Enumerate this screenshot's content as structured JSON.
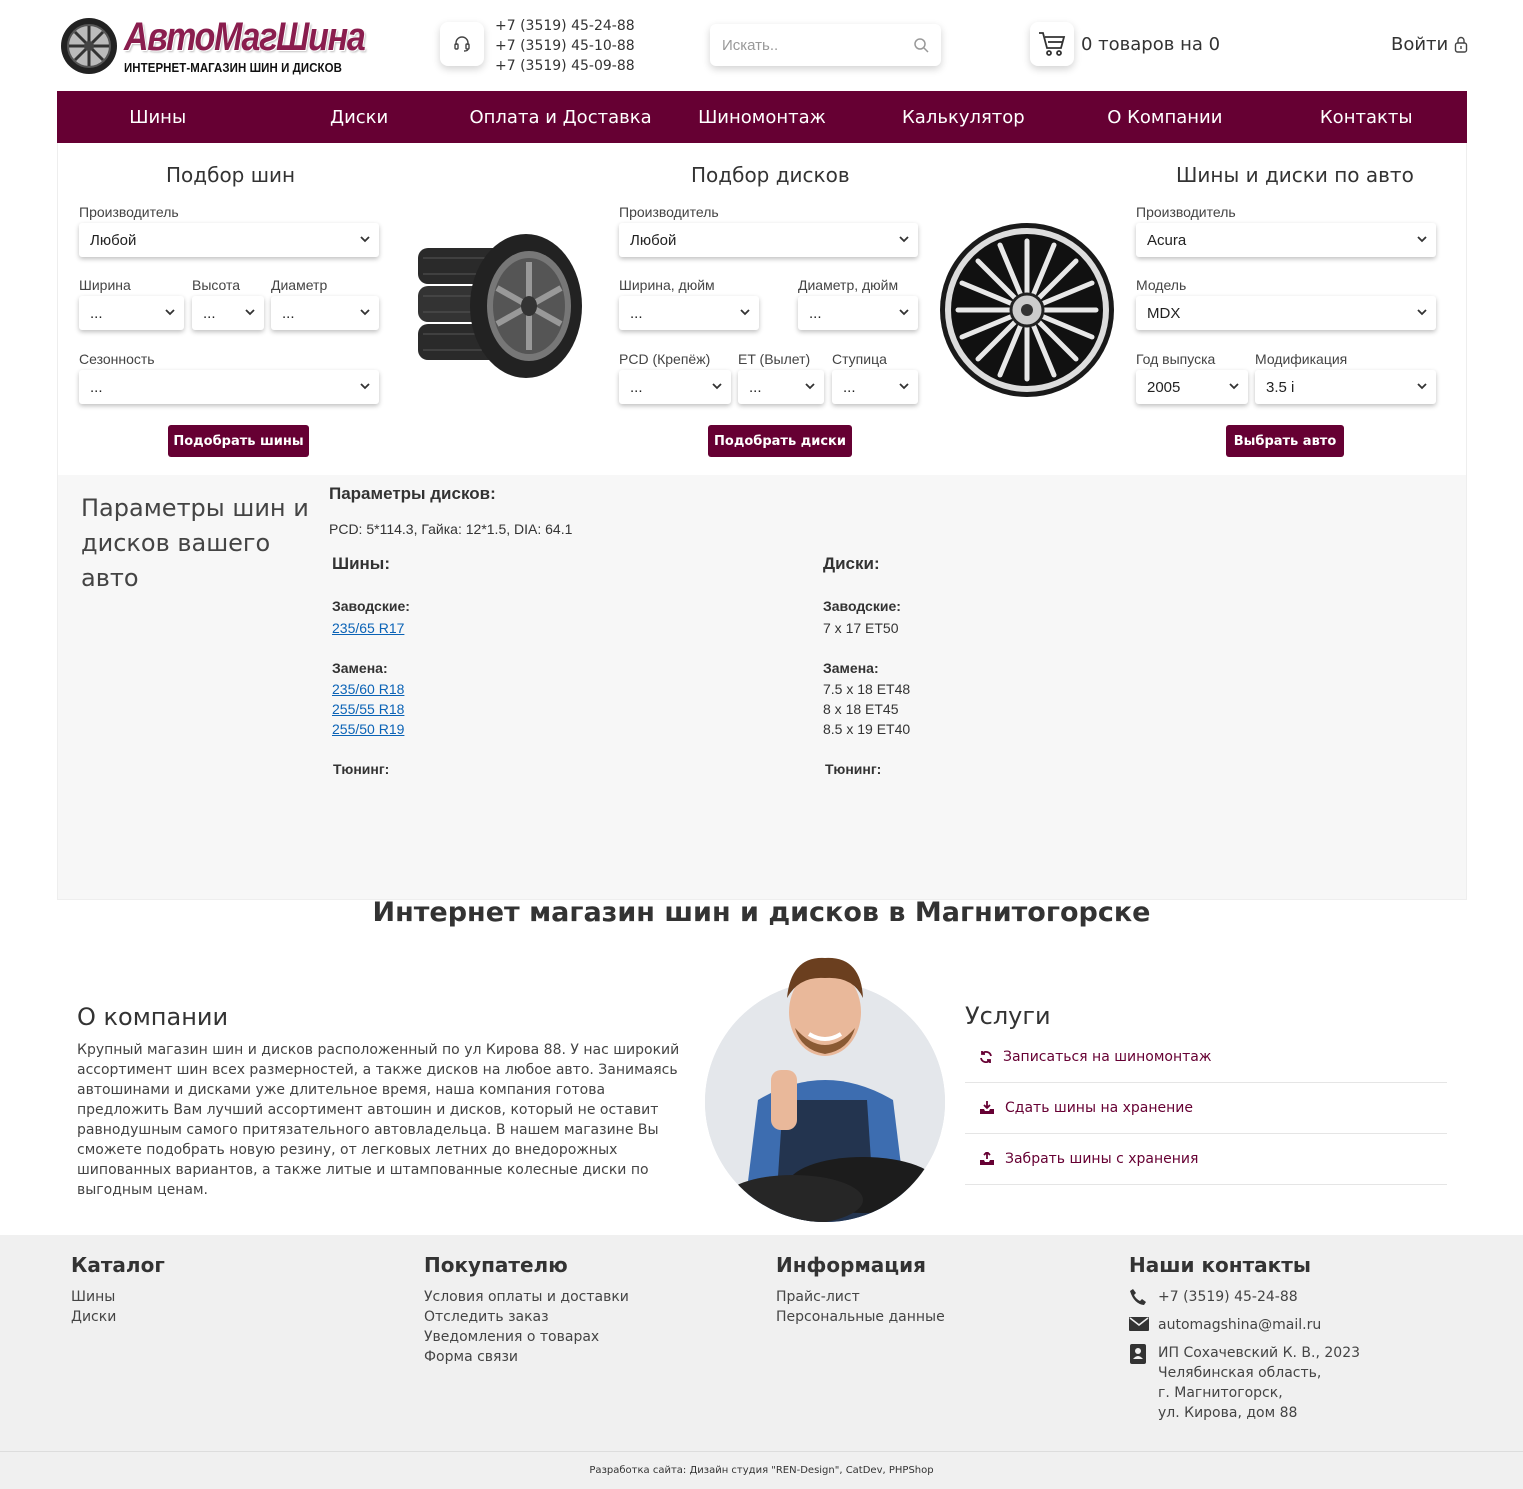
{
  "header": {
    "logo_title": "АвтоМагШина",
    "logo_subtitle": "ИНТЕРНЕТ-МАГАЗИН ШИН И ДИСКОВ",
    "phones": [
      "+7 (3519) 45-24-88",
      "+7 (3519) 45-10-88",
      "+7 (3519) 45-09-88"
    ],
    "search_placeholder": "Искать..",
    "cart_text": "0 товаров на 0",
    "login_label": "Войти"
  },
  "nav": [
    "Шины",
    "Диски",
    "Оплата и Доставка",
    "Шиномонтаж",
    "Калькулятор",
    "О Компании",
    "Контакты"
  ],
  "tire_filter": {
    "title": "Подбор шин",
    "manufacturer_label": "Производитель",
    "manufacturer_value": "Любой",
    "width_label": "Ширина",
    "width_value": "...",
    "height_label": "Высота",
    "height_value": "...",
    "diameter_label": "Диаметр",
    "diameter_value": "...",
    "season_label": "Сезонность",
    "season_value": "...",
    "button": "Подобрать шины"
  },
  "disk_filter": {
    "title": "Подбор дисков",
    "manufacturer_label": "Производитель",
    "manufacturer_value": "Любой",
    "width_label": "Ширина, дюйм",
    "width_value": "...",
    "diameter_label": "Диаметр, дюйм",
    "diameter_value": "...",
    "pcd_label": "PCD (Крепёж)",
    "pcd_value": "...",
    "et_label": "ET (Вылет)",
    "et_value": "...",
    "hub_label": "Ступица",
    "hub_value": "...",
    "button": "Подобрать диски"
  },
  "car_filter": {
    "title": "Шины и диски по авто",
    "manufacturer_label": "Производитель",
    "manufacturer_value": "Acura",
    "model_label": "Модель",
    "model_value": "MDX",
    "year_label": "Год выпуска",
    "year_value": "2005",
    "modification_label": "Модификация",
    "modification_value": "3.5 i",
    "button": "Выбрать авто"
  },
  "params": {
    "title": "Параметры шин и дисков вашего авто",
    "disk_params_label": "Параметры дисков:",
    "disk_params_value": "PCD: 5*114.3, Гайка: 12*1.5, DIA: 64.1",
    "tires": {
      "label": "Шины:",
      "factory_label": "Заводские:",
      "factory": [
        "235/65 R17"
      ],
      "replace_label": "Замена:",
      "replace": [
        "235/60 R18",
        "255/55 R18",
        "255/50 R19"
      ],
      "tuning_label": "Тюнинг:"
    },
    "disks": {
      "label": "Диски:",
      "factory_label": "Заводские:",
      "factory": [
        "7 x 17 ET50"
      ],
      "replace_label": "Замена:",
      "replace": [
        "7.5 x 18 ET48",
        "8 x 18 ET45",
        "8.5 x 19 ET40"
      ],
      "tuning_label": "Тюнинг:"
    }
  },
  "about": {
    "heading": "Интернет магазин шин и дисков в Магнитогорске",
    "title": "О компании",
    "text": "Крупный магазин шин и дисков расположенный по ул Кирова 88. У нас широкий ассортимент шин всех размерностей, а также дисков на любое авто. Занимаясь автошинами и дисками уже длительное время, наша компания готова предложить Вам лучший ассортимент автошин и дисков, который не оставит равнодушным самого притязательного автовладельца. В нашем магазине Вы сможете подобрать новую резину, от легковых летних до внедорожных шипованных вариантов, а также литые и штампованные колесные диски по выгодным ценам.",
    "services_title": "Услуги",
    "services": [
      "Записаться на шиномонтаж",
      "Сдать шины на хранение",
      "Забрать шины с хранения"
    ]
  },
  "footer": {
    "catalog_title": "Каталог",
    "catalog": [
      "Шины",
      "Диски"
    ],
    "buyer_title": "Покупателю",
    "buyer": [
      "Условия оплаты и доставки",
      "Отследить заказ",
      "Уведомления о товарах",
      "Форма связи"
    ],
    "info_title": "Информация",
    "info": [
      "Прайс-лист",
      "Персональные данные"
    ],
    "contacts_title": "Наши контакты",
    "phone": "+7 (3519) 45-24-88",
    "email": "automagshina@mail.ru",
    "address": [
      "ИП Сохачевский К. В., 2023",
      "Челябинская область,",
      "г. Магнитогорск,",
      "ул. Кирова, дом 88"
    ],
    "copyright": "Разработка сайта: Дизайн студия \"REN-Design\", CatDev, PHPShop"
  },
  "colors": {
    "brand": "#660033",
    "link": "#0b63b6"
  }
}
